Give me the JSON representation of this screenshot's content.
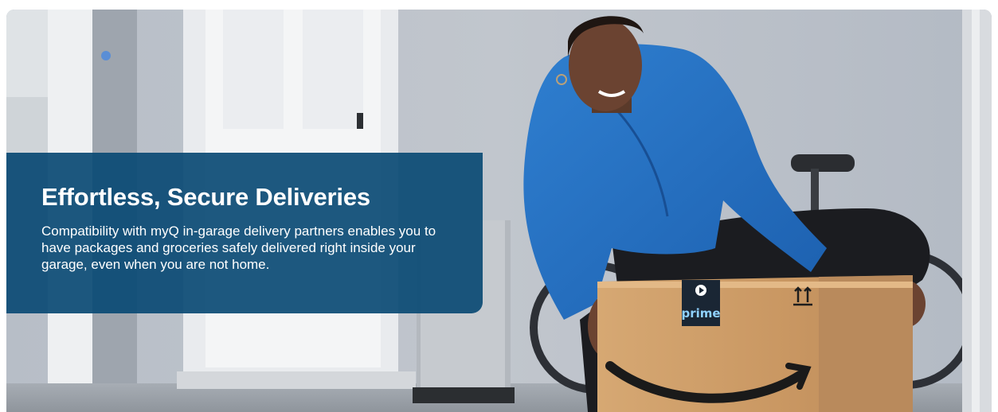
{
  "hero": {
    "headline": "Effortless, Secure Deliveries",
    "description": "Compatibility with myQ in-garage delivery partners enables you to have packages and groceries safely delivered right inside your garage, even when you are not home.",
    "image_label": "prime",
    "panel_color": "#0a4a74"
  }
}
